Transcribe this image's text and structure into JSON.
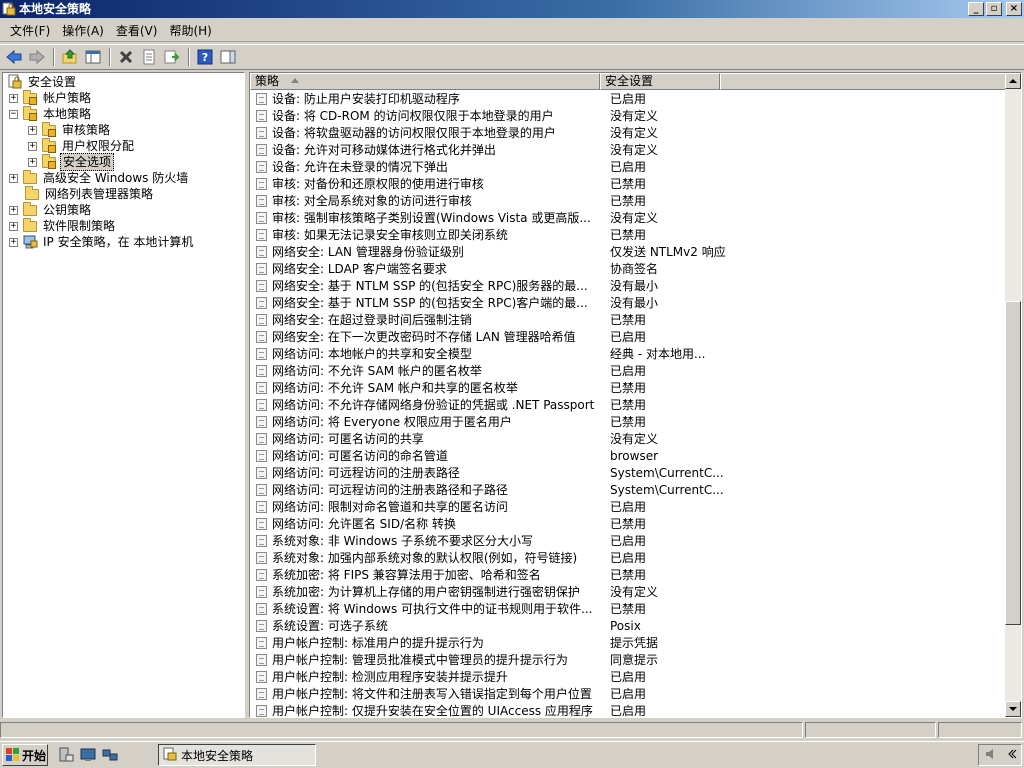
{
  "window": {
    "title": "本地安全策略",
    "minimize": "_",
    "maximize": "▫",
    "close": "×"
  },
  "menu": [
    {
      "label": "文件(F)"
    },
    {
      "label": "操作(A)"
    },
    {
      "label": "查看(V)"
    },
    {
      "label": "帮助(H)"
    }
  ],
  "toolbar": {
    "buttons": [
      "back-icon",
      "forward-icon",
      "up-icon",
      "show-hide-tree-icon",
      "delete-icon",
      "properties-icon",
      "export-list-icon",
      "help-icon",
      "show-hide-action-pane-icon"
    ]
  },
  "tree": {
    "items": [
      {
        "label": "安全设置",
        "expander": "",
        "selected": false
      },
      {
        "label": "帐户策略",
        "expander": "+",
        "selected": false
      },
      {
        "label": "本地策略",
        "expander": "−",
        "selected": false
      },
      {
        "label": "审核策略",
        "expander": "+",
        "selected": false
      },
      {
        "label": "用户权限分配",
        "expander": "+",
        "selected": false
      },
      {
        "label": "安全选项",
        "expander": "+",
        "selected": true
      },
      {
        "label": "高级安全 Windows 防火墙",
        "expander": "+",
        "selected": false
      },
      {
        "label": "网络列表管理器策略",
        "expander": "",
        "selected": false
      },
      {
        "label": "公钥策略",
        "expander": "+",
        "selected": false
      },
      {
        "label": "软件限制策略",
        "expander": "+",
        "selected": false
      },
      {
        "label": "IP 安全策略，在 本地计算机",
        "expander": "+",
        "selected": false
      }
    ]
  },
  "list": {
    "columns": {
      "policy": "策略",
      "setting": "安全设置"
    },
    "rows": [
      {
        "policy": "设备: 防止用户安装打印机驱动程序",
        "setting": "已启用"
      },
      {
        "policy": "设备: 将 CD-ROM 的访问权限仅限于本地登录的用户",
        "setting": "没有定义"
      },
      {
        "policy": "设备: 将软盘驱动器的访问权限仅限于本地登录的用户",
        "setting": "没有定义"
      },
      {
        "policy": "设备: 允许对可移动媒体进行格式化并弹出",
        "setting": "没有定义"
      },
      {
        "policy": "设备: 允许在未登录的情况下弹出",
        "setting": "已启用"
      },
      {
        "policy": "审核: 对备份和还原权限的使用进行审核",
        "setting": "已禁用"
      },
      {
        "policy": "审核: 对全局系统对象的访问进行审核",
        "setting": "已禁用"
      },
      {
        "policy": "审核: 强制审核策略子类别设置(Windows Vista 或更高版...",
        "setting": "没有定义"
      },
      {
        "policy": "审核: 如果无法记录安全审核则立即关闭系统",
        "setting": "已禁用"
      },
      {
        "policy": "网络安全: LAN 管理器身份验证级别",
        "setting": "仅发送 NTLMv2 响应"
      },
      {
        "policy": "网络安全: LDAP 客户端签名要求",
        "setting": "协商签名"
      },
      {
        "policy": "网络安全: 基于 NTLM SSP 的(包括安全 RPC)服务器的最...",
        "setting": "没有最小"
      },
      {
        "policy": "网络安全: 基于 NTLM SSP 的(包括安全 RPC)客户端的最...",
        "setting": "没有最小"
      },
      {
        "policy": "网络安全: 在超过登录时间后强制注销",
        "setting": "已禁用"
      },
      {
        "policy": "网络安全: 在下一次更改密码时不存储 LAN 管理器哈希值",
        "setting": "已启用"
      },
      {
        "policy": "网络访问: 本地帐户的共享和安全模型",
        "setting": "经典 - 对本地用..."
      },
      {
        "policy": "网络访问: 不允许 SAM 帐户的匿名枚举",
        "setting": "已启用"
      },
      {
        "policy": "网络访问: 不允许 SAM 帐户和共享的匿名枚举",
        "setting": "已禁用"
      },
      {
        "policy": "网络访问: 不允许存储网络身份验证的凭据或 .NET Passport",
        "setting": "已禁用"
      },
      {
        "policy": "网络访问: 将 Everyone 权限应用于匿名用户",
        "setting": "已禁用"
      },
      {
        "policy": "网络访问: 可匿名访问的共享",
        "setting": "没有定义"
      },
      {
        "policy": "网络访问: 可匿名访问的命名管道",
        "setting": "browser"
      },
      {
        "policy": "网络访问: 可远程访问的注册表路径",
        "setting": "System\\CurrentC..."
      },
      {
        "policy": "网络访问: 可远程访问的注册表路径和子路径",
        "setting": "System\\CurrentC..."
      },
      {
        "policy": "网络访问: 限制对命名管道和共享的匿名访问",
        "setting": "已启用"
      },
      {
        "policy": "网络访问: 允许匿名 SID/名称 转换",
        "setting": "已禁用"
      },
      {
        "policy": "系统对象: 非 Windows 子系统不要求区分大小写",
        "setting": "已启用"
      },
      {
        "policy": "系统对象: 加强内部系统对象的默认权限(例如，符号链接)",
        "setting": "已启用"
      },
      {
        "policy": "系统加密: 将 FIPS 兼容算法用于加密、哈希和签名",
        "setting": "已禁用"
      },
      {
        "policy": "系统加密: 为计算机上存储的用户密钥强制进行强密钥保护",
        "setting": "没有定义"
      },
      {
        "policy": "系统设置: 将 Windows 可执行文件中的证书规则用于软件...",
        "setting": "已禁用"
      },
      {
        "policy": "系统设置: 可选子系统",
        "setting": "Posix"
      },
      {
        "policy": "用户帐户控制: 标准用户的提升提示行为",
        "setting": "提示凭据"
      },
      {
        "policy": "用户帐户控制: 管理员批准模式中管理员的提升提示行为",
        "setting": "同意提示"
      },
      {
        "policy": "用户帐户控制: 检测应用程序安装并提示提升",
        "setting": "已启用"
      },
      {
        "policy": "用户帐户控制: 将文件和注册表写入错误指定到每个用户位置",
        "setting": "已启用"
      },
      {
        "policy": "用户帐户控制: 仅提升安装在安全位置的 UIAccess 应用程序",
        "setting": "已启用"
      }
    ]
  },
  "taskbar": {
    "start_label": "开始",
    "task_label": "本地安全策略",
    "quick_launch": [
      "server-manager-icon",
      "show-desktop-icon",
      "network-icon"
    ],
    "tray": [
      "volume-icon",
      "chevron-left-icon"
    ]
  },
  "colors": {
    "title_start": "#0a246a",
    "title_end": "#a6caf0",
    "face": "#d4d0c8"
  }
}
